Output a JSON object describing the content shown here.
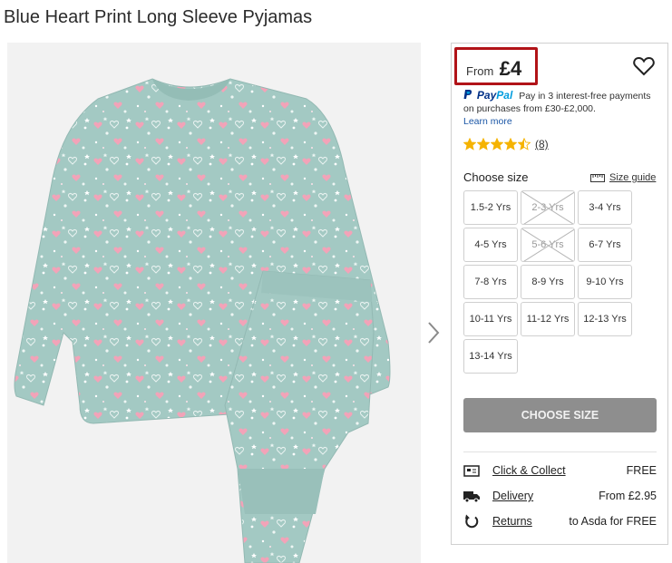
{
  "product": {
    "title": "Blue Heart Print Long Sleeve Pyjamas"
  },
  "price": {
    "from_label": "From",
    "amount": "£4"
  },
  "paypal": {
    "logo_pay": "Pay",
    "logo_pal": "Pal",
    "text_line1": "Pay in 3 interest-free payments",
    "text_line2": "on purchases from £30-£2,000.",
    "learn_more": "Learn more"
  },
  "rating": {
    "stars": 4.5,
    "max": 5,
    "count": "(8)",
    "star_color": "#f5b301"
  },
  "sizes": {
    "label": "Choose size",
    "guide_label": "Size guide",
    "options": [
      {
        "label": "1.5-2 Yrs",
        "available": true
      },
      {
        "label": "2-3 Yrs",
        "available": false
      },
      {
        "label": "3-4 Yrs",
        "available": true
      },
      {
        "label": "4-5 Yrs",
        "available": true
      },
      {
        "label": "5-6 Yrs",
        "available": false
      },
      {
        "label": "6-7 Yrs",
        "available": true
      },
      {
        "label": "7-8 Yrs",
        "available": true
      },
      {
        "label": "8-9 Yrs",
        "available": true
      },
      {
        "label": "9-10 Yrs",
        "available": true
      },
      {
        "label": "10-11 Yrs",
        "available": true
      },
      {
        "label": "11-12 Yrs",
        "available": true
      },
      {
        "label": "12-13 Yrs",
        "available": true
      },
      {
        "label": "13-14 Yrs",
        "available": true
      }
    ]
  },
  "cta": {
    "label": "CHOOSE SIZE"
  },
  "delivery": [
    {
      "icon": "click-collect-icon",
      "label": "Click & Collect",
      "value": "FREE"
    },
    {
      "icon": "delivery-truck-icon",
      "label": "Delivery",
      "value": "From £2.95"
    },
    {
      "icon": "returns-icon",
      "label": "Returns",
      "value": "to Asda for FREE"
    }
  ],
  "colors": {
    "accent_red": "#b11318",
    "pyjama_fabric": "#a3c9c3",
    "heart_pink": "#f2a3b8",
    "button_grey": "#8e8e8e"
  }
}
